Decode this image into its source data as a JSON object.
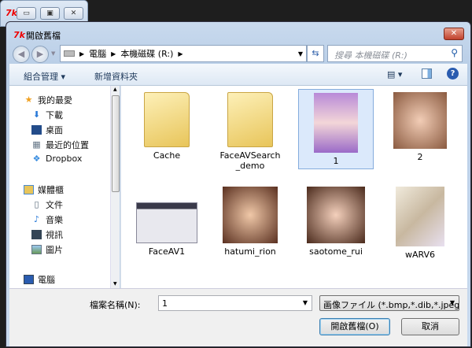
{
  "parent_window": {
    "logo": "7k",
    "buttons": [
      "minimize",
      "maximize",
      "close"
    ]
  },
  "dialog": {
    "title": "開啟舊檔",
    "logo": "7k",
    "address": {
      "crumbs": [
        "電腦",
        "本機磁碟 (R:)"
      ]
    },
    "search_placeholder": "搜尋 本機磁碟 (R:)",
    "toolbar": {
      "organize": "組合管理",
      "new_folder": "新增資料夾"
    },
    "nav": {
      "favorites": {
        "label": "我的最愛",
        "items": [
          "下載",
          "桌面",
          "最近的位置",
          "Dropbox"
        ]
      },
      "libraries": {
        "label": "媒體櫃",
        "items": [
          "文件",
          "音樂",
          "視訊",
          "圖片"
        ]
      },
      "computer": "電腦"
    },
    "files": [
      {
        "name": "Cache",
        "type": "folder"
      },
      {
        "name": "FaceAVSearch_demo",
        "type": "folder"
      },
      {
        "name": "1",
        "type": "image",
        "selected": true
      },
      {
        "name": "2",
        "type": "image"
      },
      {
        "name": "FaceAV1",
        "type": "image"
      },
      {
        "name": "hatumi_rion",
        "type": "image"
      },
      {
        "name": "saotome_rui",
        "type": "image"
      },
      {
        "name": "wARV6",
        "type": "image"
      }
    ],
    "filename_label": "檔案名稱(N):",
    "filename_value": "1",
    "filter": "画像ファイル (*.bmp,*.dib,*.jpeg",
    "open_button": "開啟舊檔(O)",
    "cancel_button": "取消"
  }
}
